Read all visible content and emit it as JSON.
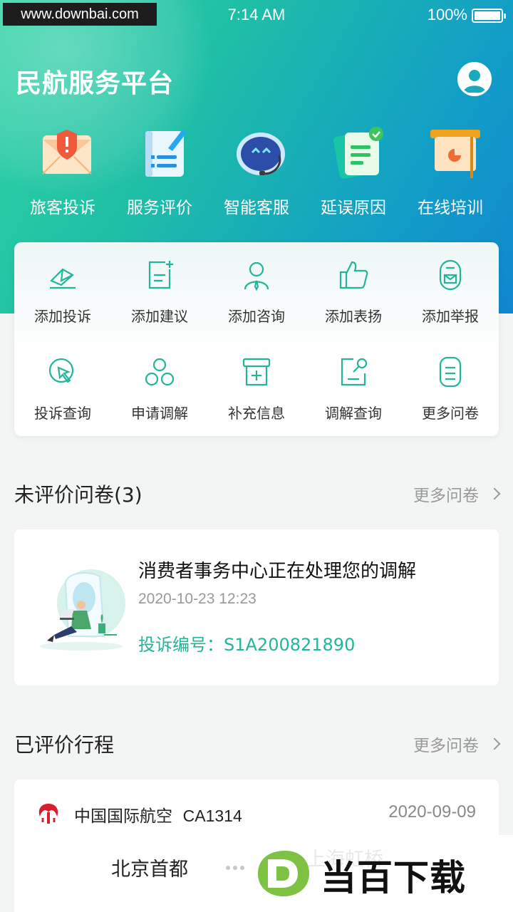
{
  "status_bar": {
    "url_watermark": "www.downbai.com",
    "time": "7:14 AM",
    "battery": "100%"
  },
  "header": {
    "title": "民航服务平台"
  },
  "top_nav": [
    {
      "label": "旅客投诉",
      "icon": "complaint-letter-icon"
    },
    {
      "label": "服务评价",
      "icon": "evaluation-notebook-icon"
    },
    {
      "label": "智能客服",
      "icon": "robot-service-icon"
    },
    {
      "label": "延误原因",
      "icon": "delay-document-icon"
    },
    {
      "label": "在线培训",
      "icon": "training-board-icon"
    }
  ],
  "quick_actions": [
    {
      "label": "添加投诉",
      "icon": "add-complaint-icon"
    },
    {
      "label": "添加建议",
      "icon": "add-suggestion-icon"
    },
    {
      "label": "添加咨询",
      "icon": "add-consult-icon"
    },
    {
      "label": "添加表扬",
      "icon": "add-praise-icon"
    },
    {
      "label": "添加举报",
      "icon": "add-report-icon"
    },
    {
      "label": "投诉查询",
      "icon": "complaint-query-icon"
    },
    {
      "label": "申请调解",
      "icon": "apply-mediation-icon"
    },
    {
      "label": "补充信息",
      "icon": "supplement-info-icon"
    },
    {
      "label": "调解查询",
      "icon": "mediation-query-icon"
    },
    {
      "label": "更多问卷",
      "icon": "more-survey-icon"
    }
  ],
  "pending_section": {
    "title": "未评价问卷(3)",
    "more": "更多问卷"
  },
  "pending_card": {
    "title": "消费者事务中心正在处理您的调解",
    "time": "2020-10-23 12:23",
    "code": "投诉编号：S1A200821890"
  },
  "rated_section": {
    "title": "已评价行程",
    "more": "更多问卷"
  },
  "trip": {
    "airline": "中国国际航空",
    "flight": "CA1314",
    "date": "2020-09-09",
    "departure": "北京首都",
    "arrival_partial": "上海虹桥"
  },
  "brand_watermark": {
    "text": "当百下载"
  },
  "colors": {
    "accent": "#22b59a",
    "hero_start": "#2fd3a4",
    "hero_end": "#1186cf"
  }
}
